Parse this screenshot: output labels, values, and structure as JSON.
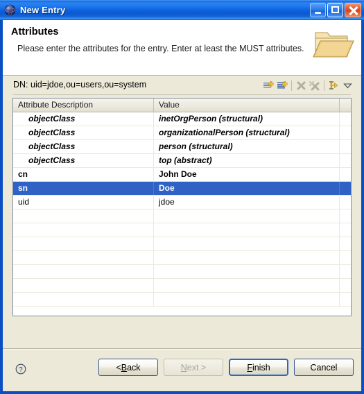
{
  "window": {
    "title": "New Entry",
    "icon": "globe-icon",
    "controls": {
      "minimize": "Minimize",
      "maximize": "Maximize",
      "close": "Close"
    }
  },
  "wizard": {
    "heading": "Attributes",
    "description": "Please enter the attributes for the entry. Enter at least the MUST attributes.",
    "banner_icon": "folder-icon"
  },
  "dn": {
    "label": "DN: uid=jdoe,ou=users,ou=system"
  },
  "toolbar": {
    "items": [
      {
        "name": "new-attribute-icon",
        "title": "New Attribute"
      },
      {
        "name": "new-value-icon",
        "title": "New Value"
      },
      {
        "name": "delete-attribute-icon",
        "title": "Delete Attribute"
      },
      {
        "name": "delete-all-values-icon",
        "title": "Delete All Values"
      },
      {
        "name": "expand-all-icon",
        "title": "Expand All"
      },
      {
        "name": "chevron-down-icon",
        "title": "View Menu"
      }
    ]
  },
  "table": {
    "columns": [
      "Attribute Description",
      "Value"
    ],
    "selected_row_index": 5,
    "selection_color": "#2f62c4",
    "rows": [
      {
        "attribute": "objectClass",
        "value": "inetOrgPerson (structural)",
        "style": "objectclass"
      },
      {
        "attribute": "objectClass",
        "value": "organizationalPerson (structural)",
        "style": "objectclass"
      },
      {
        "attribute": "objectClass",
        "value": "person (structural)",
        "style": "objectclass"
      },
      {
        "attribute": "objectClass",
        "value": "top (abstract)",
        "style": "objectclass"
      },
      {
        "attribute": "cn",
        "value": "John Doe",
        "style": "must"
      },
      {
        "attribute": "sn",
        "value": "Doe",
        "style": "must"
      },
      {
        "attribute": "uid",
        "value": "jdoe",
        "style": "normal"
      }
    ],
    "empty_row_count": 7
  },
  "footer": {
    "help_icon": "help-icon",
    "buttons": [
      {
        "name": "back-button",
        "label": "< Back",
        "mnemonic": "B",
        "state": "enabled"
      },
      {
        "name": "next-button",
        "label": "Next >",
        "mnemonic": "N",
        "state": "disabled"
      },
      {
        "name": "finish-button",
        "label": "Finish",
        "mnemonic": "F",
        "state": "default"
      },
      {
        "name": "cancel-button",
        "label": "Cancel",
        "mnemonic": "",
        "state": "enabled"
      }
    ]
  }
}
